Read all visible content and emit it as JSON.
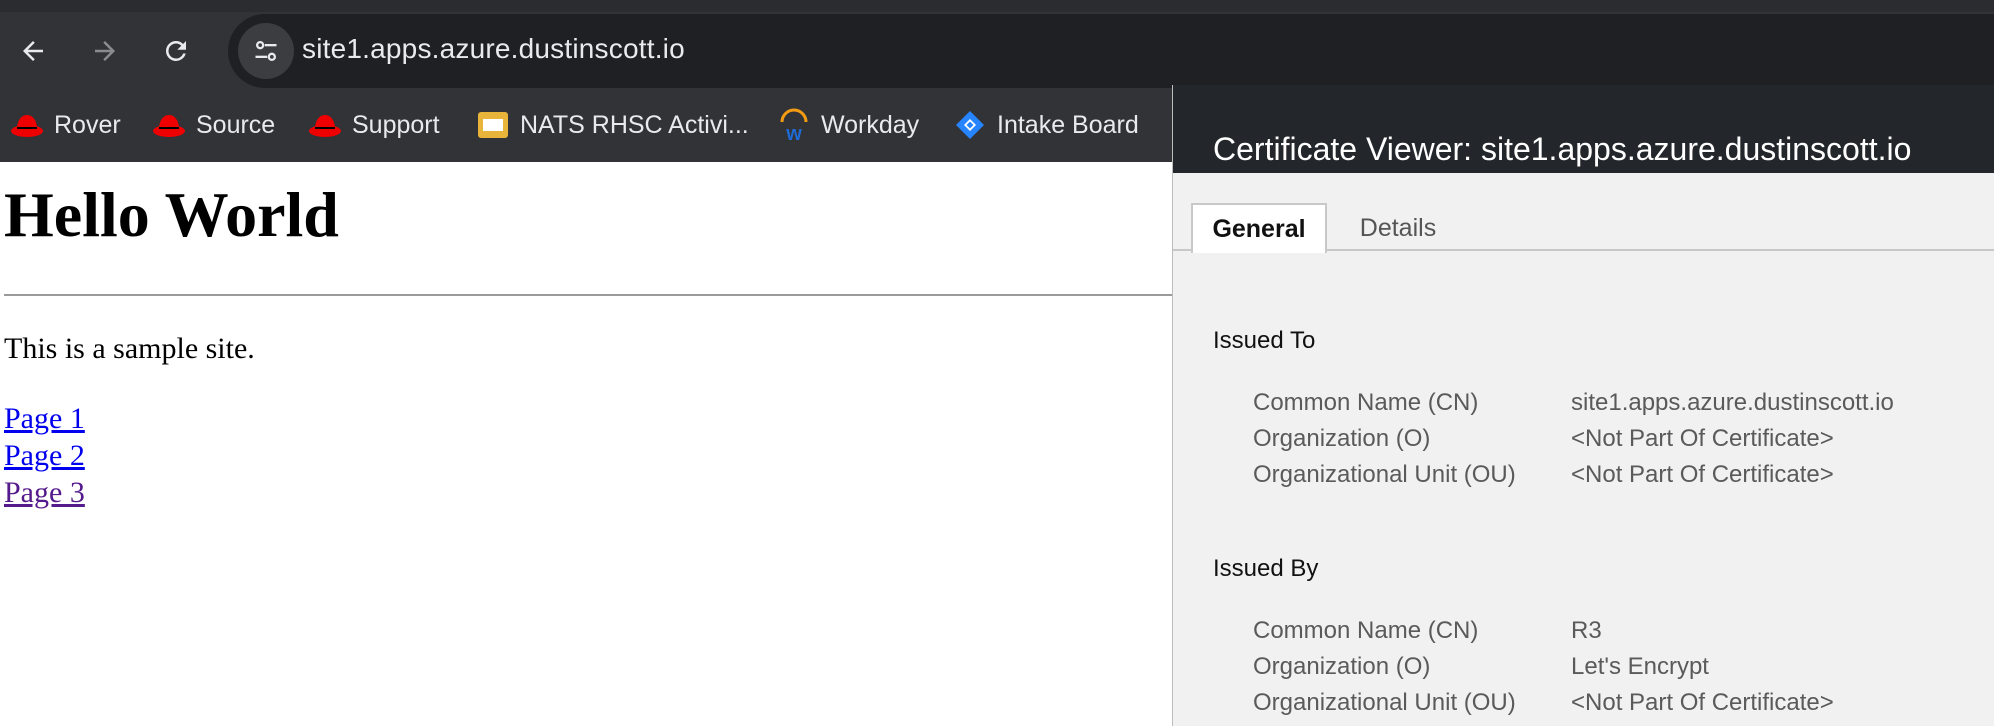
{
  "browser": {
    "url": "site1.apps.azure.dustinscott.io",
    "bookmarks": [
      {
        "label": "Rover",
        "icon": "redhat-icon"
      },
      {
        "label": "Source",
        "icon": "redhat-icon"
      },
      {
        "label": "Support",
        "icon": "redhat-icon"
      },
      {
        "label": "NATS RHSC Activi...",
        "icon": "folder-icon"
      },
      {
        "label": "Workday",
        "icon": "workday-icon"
      },
      {
        "label": "Intake Board",
        "icon": "jira-icon"
      }
    ]
  },
  "page": {
    "heading": "Hello World",
    "paragraph": "This is a sample site.",
    "links": [
      "Page 1",
      "Page 2",
      "Page 3"
    ]
  },
  "certificate_viewer": {
    "title": "Certificate Viewer: site1.apps.azure.dustinscott.io",
    "tabs": [
      "General",
      "Details"
    ],
    "active_tab": "General",
    "issued_to": {
      "title": "Issued To",
      "fields": [
        {
          "key": "Common Name (CN)",
          "value": "site1.apps.azure.dustinscott.io"
        },
        {
          "key": "Organization (O)",
          "value": "<Not Part Of Certificate>"
        },
        {
          "key": "Organizational Unit (OU)",
          "value": "<Not Part Of Certificate>"
        }
      ]
    },
    "issued_by": {
      "title": "Issued By",
      "fields": [
        {
          "key": "Common Name (CN)",
          "value": "R3"
        },
        {
          "key": "Organization (O)",
          "value": "Let's Encrypt"
        },
        {
          "key": "Organizational Unit (OU)",
          "value": "<Not Part Of Certificate>"
        }
      ]
    }
  },
  "colors": {
    "toolbar": "#323337",
    "omnibox": "#1f2023",
    "dialog_header": "#23272b",
    "link": "#0000ee",
    "visited_link": "#551a8b"
  }
}
